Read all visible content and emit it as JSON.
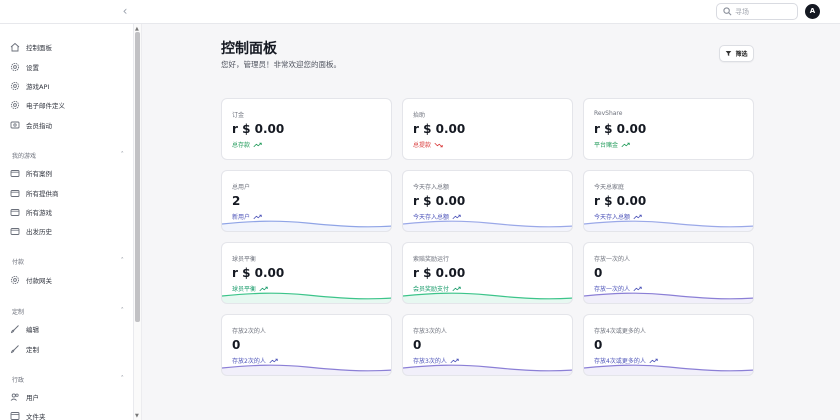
{
  "topbar": {
    "search_placeholder": "寻场",
    "avatar_initial": "A"
  },
  "sidebar": {
    "items": [
      {
        "label": "控制面板",
        "icon": "home-icon"
      },
      {
        "label": "设置",
        "icon": "gear-icon"
      },
      {
        "label": "游戏API",
        "icon": "gear-icon"
      },
      {
        "label": "电子邮件定义",
        "icon": "gear-icon"
      },
      {
        "label": "会员指动",
        "icon": "card-icon"
      }
    ],
    "sections": [
      {
        "title": "我的游戏",
        "items": [
          {
            "label": "所有案例",
            "icon": "folder-icon"
          },
          {
            "label": "所有提供商",
            "icon": "folder-icon"
          },
          {
            "label": "所有游戏",
            "icon": "folder-icon"
          },
          {
            "label": "出发历史",
            "icon": "folder-icon"
          }
        ]
      },
      {
        "title": "付款",
        "items": [
          {
            "label": "付款网关",
            "icon": "gear-icon"
          }
        ]
      },
      {
        "title": "定制",
        "items": [
          {
            "label": "编辑",
            "icon": "brush-icon"
          },
          {
            "label": "定制",
            "icon": "brush-icon"
          }
        ]
      },
      {
        "title": "行政",
        "items": [
          {
            "label": "用户",
            "icon": "users-icon"
          },
          {
            "label": "文件夹",
            "icon": "file-icon"
          }
        ]
      }
    ]
  },
  "main": {
    "title": "控制面板",
    "subtitle": "您好，管理员！非常欢迎您的面板。",
    "filter_label": "筛选"
  },
  "cards": [
    {
      "title": "订金",
      "value": "r $ 0.00",
      "desc": "总存款",
      "trend": "up",
      "tone": "green",
      "spark": false
    },
    {
      "title": "抬助",
      "value": "r $ 0.00",
      "desc": "总提款",
      "trend": "down",
      "tone": "red",
      "spark": false
    },
    {
      "title": "RevShare",
      "value": "r $ 0.00",
      "desc": "平台赌金",
      "trend": "up",
      "tone": "green",
      "spark": false
    },
    {
      "title": "总用户",
      "value": "2",
      "desc": "新用户",
      "trend": "up",
      "tone": "blue",
      "spark": true,
      "spark_color": "#8fa4e6"
    },
    {
      "title": "今天存入总额",
      "value": "r $ 0.00",
      "desc": "今天存入总额",
      "trend": "up",
      "tone": "blue",
      "spark": true,
      "spark_color": "#9aa8e8"
    },
    {
      "title": "今天总家庭",
      "value": "r $ 0.00",
      "desc": "今天存入总额",
      "trend": "up",
      "tone": "blue",
      "spark": true,
      "spark_color": "#9aa8e8"
    },
    {
      "title": "球员平衡",
      "value": "r $ 0.00",
      "desc": "球员平衡",
      "trend": "up",
      "tone": "teal",
      "spark": true,
      "spark_color": "#3cc48a"
    },
    {
      "title": "索赔奖励运行",
      "value": "r $ 0.00",
      "desc": "会员奖励支付",
      "trend": "up",
      "tone": "teal",
      "spark": true,
      "spark_color": "#3cc48a"
    },
    {
      "title": "存放一次的人",
      "value": "0",
      "desc": "存放一次的人",
      "trend": "up",
      "tone": "blue",
      "spark": true,
      "spark_color": "#8b7fd6"
    },
    {
      "title": "存放2次的人",
      "value": "0",
      "desc": "存放2次的人",
      "trend": "up",
      "tone": "blue",
      "spark": true,
      "spark_color": "#8b7fd6"
    },
    {
      "title": "存放3次的人",
      "value": "0",
      "desc": "存放3次的人",
      "trend": "up",
      "tone": "blue",
      "spark": true,
      "spark_color": "#8b7fd6"
    },
    {
      "title": "存放4次或更多的人",
      "value": "0",
      "desc": "存放4次或更多的人",
      "trend": "up",
      "tone": "blue",
      "spark": true,
      "spark_color": "#8b7fd6"
    }
  ]
}
